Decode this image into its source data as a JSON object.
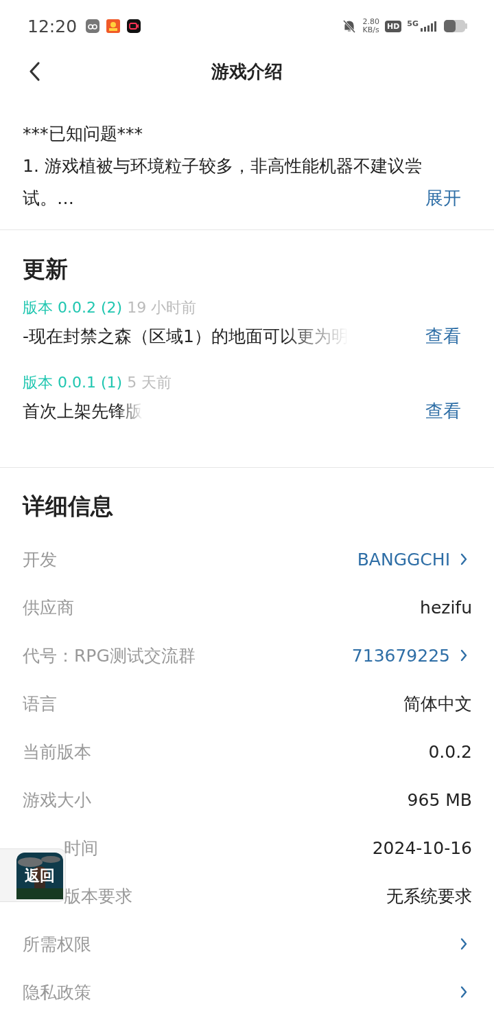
{
  "status_bar": {
    "time": "12:20",
    "net_speed": "2.80",
    "net_unit": "KB/s",
    "hd": "HD",
    "network": "5G"
  },
  "header": {
    "title": "游戏介绍"
  },
  "description": {
    "lines": [
      "***已知问题***",
      "1. 游戏植被与环境粒子较多，非高性能机器不建议尝",
      "试。…"
    ],
    "expand": "展开"
  },
  "updates": {
    "title": "更新",
    "items": [
      {
        "version": "版本 0.0.2 (2)",
        "time": "19 小时前",
        "text": "-现在封禁之森（区域1）的地面可以更为明",
        "action": "查看"
      },
      {
        "version": "版本 0.0.1 (1)",
        "time": "5 天前",
        "text": "首次上架先锋版",
        "action": "查看"
      }
    ]
  },
  "details": {
    "title": "详细信息",
    "rows": [
      {
        "label": "开发",
        "value": "BANGGCHI",
        "kind": "link"
      },
      {
        "label": "供应商",
        "value": "hezifu",
        "kind": "text"
      },
      {
        "label": "代号：RPG测试交流群",
        "value": "713679225",
        "kind": "link"
      },
      {
        "label": "语言",
        "value": "简体中文",
        "kind": "text"
      },
      {
        "label": "当前版本",
        "value": "0.0.2",
        "kind": "text"
      },
      {
        "label": "游戏大小",
        "value": "965 MB",
        "kind": "text"
      },
      {
        "label": "时间",
        "value": "2024-10-16",
        "kind": "text"
      },
      {
        "label": "版本要求",
        "value": "无系统要求",
        "kind": "text"
      },
      {
        "label": "所需权限",
        "kind": "arrow"
      },
      {
        "label": "隐私政策",
        "kind": "arrow"
      }
    ]
  },
  "floating_back": {
    "label": "返回"
  }
}
